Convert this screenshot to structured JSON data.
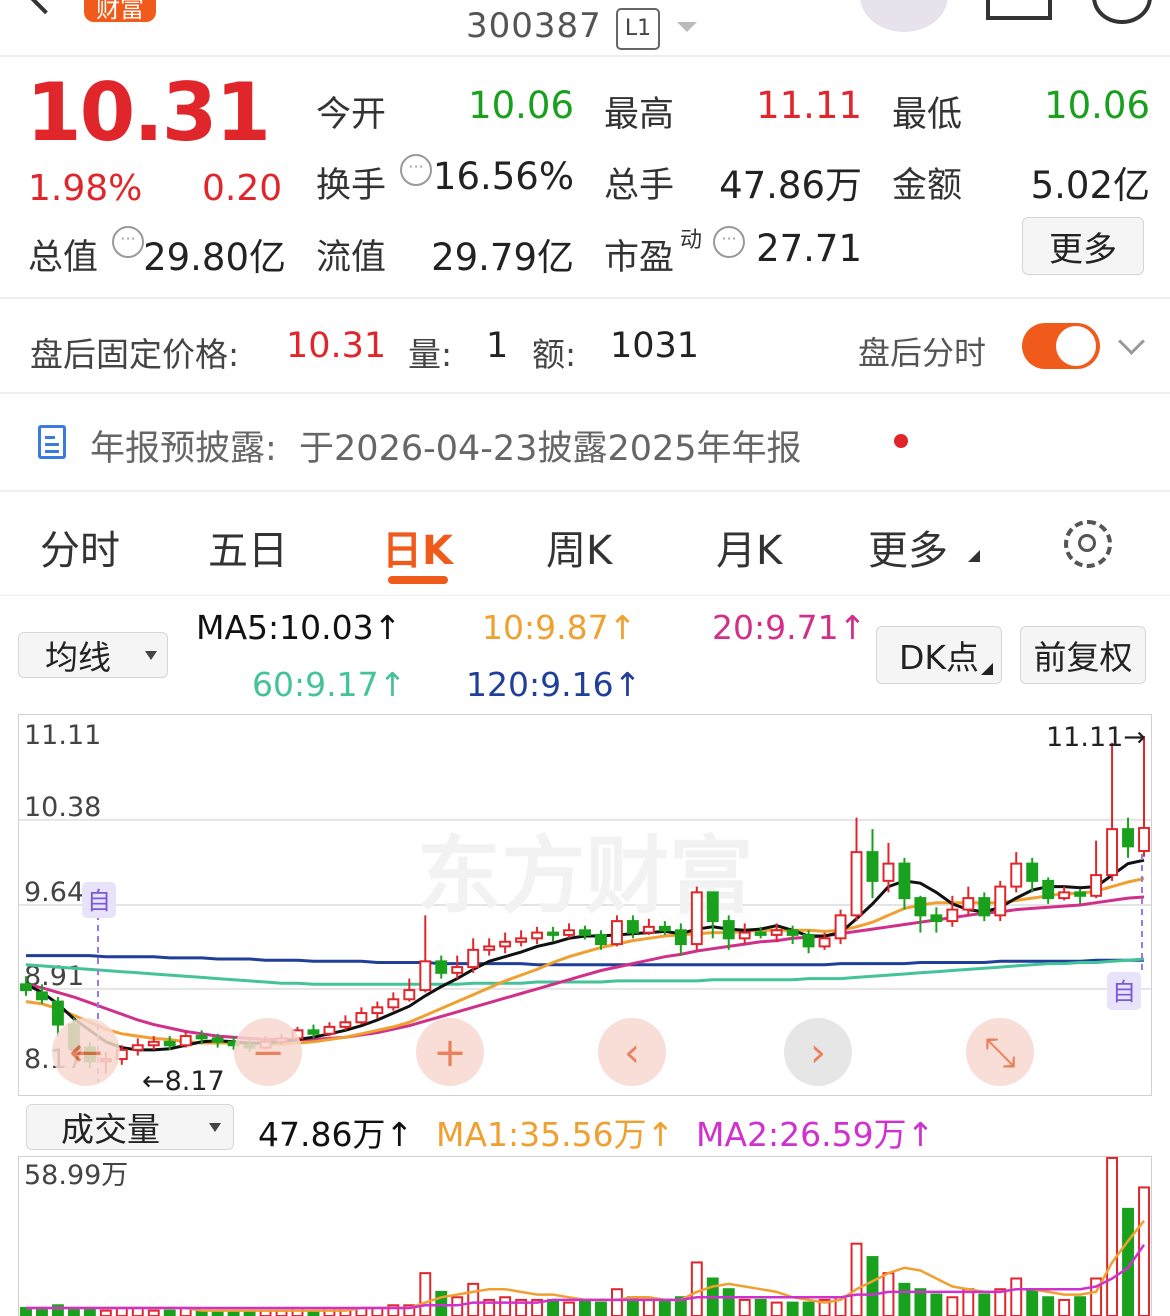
{
  "header": {
    "badge": "财富",
    "code": "300387",
    "level": "L1"
  },
  "quote": {
    "price": "10.31",
    "pct": "1.98%",
    "chg": "0.20",
    "open_label": "今开",
    "open": "10.06",
    "high_label": "最高",
    "high": "11.11",
    "low_label": "最低",
    "low": "10.06",
    "turnover_label": "换手",
    "turnover": "16.56%",
    "volume_label": "总手",
    "volume": "47.86万",
    "amount_label": "金额",
    "amount": "5.02亿",
    "mktcap_label": "总值",
    "mktcap": "29.80亿",
    "float_label": "流值",
    "float": "29.79亿",
    "pe_label": "市盈",
    "pe_sup": "动",
    "pe": "27.71",
    "more": "更多"
  },
  "afterhours": {
    "label": "盘后固定价格:",
    "price": "10.31",
    "qty_label": "量:",
    "qty": "1",
    "amt_label": "额:",
    "amt": "1031",
    "toggle_label": "盘后分时",
    "toggle_on": true
  },
  "notice": {
    "text": "年报预披露:  于2026-04-23披露2025年年报"
  },
  "tabs": [
    "分时",
    "五日",
    "日K",
    "周K",
    "月K",
    "更多"
  ],
  "indicators": {
    "ma_select": "均线",
    "ma5": "MA5:10.03↑",
    "ma10": "10:9.87↑",
    "ma20": "20:9.71↑",
    "ma60": "60:9.17↑",
    "ma120": "120:9.16↑",
    "dk": "DK点",
    "fq": "前复权"
  },
  "kchart": {
    "yticks": [
      "11.11",
      "10.38",
      "9.64",
      "8.91",
      "8.17"
    ],
    "high_label": "11.11→",
    "low_label": "←8.17",
    "watermark": "东方财富",
    "auto_mark": "自"
  },
  "volume": {
    "select": "成交量",
    "value": "47.86万↑",
    "ma1": "MA1:35.56万↑",
    "ma2": "MA2:26.59万↑",
    "ytop": "58.99万"
  },
  "colors": {
    "up": "#e0262b",
    "down": "#19a11e",
    "ma5": "#111111",
    "ma10": "#f0a030",
    "ma20": "#d0308a",
    "ma60": "#44c29a",
    "ma120": "#1f3f9a",
    "accent": "#f05a1a"
  },
  "chart_data": {
    "type": "candlestick",
    "ylim": [
      8.17,
      11.11
    ],
    "candles": [
      [
        8.95,
        8.9,
        9.02,
        8.85
      ],
      [
        8.88,
        8.82,
        8.95,
        8.78
      ],
      [
        8.8,
        8.6,
        8.84,
        8.5
      ],
      [
        8.6,
        8.4,
        8.66,
        8.36
      ],
      [
        8.4,
        8.28,
        8.45,
        8.22
      ],
      [
        8.28,
        8.3,
        8.36,
        8.17
      ],
      [
        8.3,
        8.38,
        8.42,
        8.25
      ],
      [
        8.38,
        8.42,
        8.48,
        8.33
      ],
      [
        8.42,
        8.45,
        8.5,
        8.38
      ],
      [
        8.45,
        8.42,
        8.5,
        8.38
      ],
      [
        8.42,
        8.5,
        8.55,
        8.4
      ],
      [
        8.5,
        8.48,
        8.55,
        8.43
      ],
      [
        8.48,
        8.45,
        8.52,
        8.4
      ],
      [
        8.45,
        8.42,
        8.5,
        8.38
      ],
      [
        8.42,
        8.4,
        8.47,
        8.36
      ],
      [
        8.4,
        8.45,
        8.5,
        8.38
      ],
      [
        8.45,
        8.48,
        8.52,
        8.42
      ],
      [
        8.48,
        8.55,
        8.58,
        8.45
      ],
      [
        8.55,
        8.52,
        8.6,
        8.48
      ],
      [
        8.52,
        8.58,
        8.62,
        8.5
      ],
      [
        8.58,
        8.62,
        8.68,
        8.55
      ],
      [
        8.62,
        8.7,
        8.75,
        8.6
      ],
      [
        8.7,
        8.75,
        8.8,
        8.65
      ],
      [
        8.75,
        8.82,
        8.88,
        8.72
      ],
      [
        8.82,
        8.9,
        9.0,
        8.8
      ],
      [
        8.9,
        9.15,
        9.55,
        8.88
      ],
      [
        9.15,
        9.05,
        9.2,
        9.0
      ],
      [
        9.05,
        9.1,
        9.2,
        9.0
      ],
      [
        9.1,
        9.25,
        9.35,
        9.05
      ],
      [
        9.25,
        9.28,
        9.35,
        9.2
      ],
      [
        9.28,
        9.32,
        9.4,
        9.22
      ],
      [
        9.32,
        9.35,
        9.42,
        9.28
      ],
      [
        9.35,
        9.4,
        9.45,
        9.3
      ],
      [
        9.4,
        9.38,
        9.45,
        9.32
      ],
      [
        9.38,
        9.42,
        9.48,
        9.35
      ],
      [
        9.42,
        9.38,
        9.46,
        9.34
      ],
      [
        9.38,
        9.3,
        9.42,
        9.25
      ],
      [
        9.3,
        9.5,
        9.55,
        9.28
      ],
      [
        9.5,
        9.4,
        9.55,
        9.35
      ],
      [
        9.4,
        9.45,
        9.52,
        9.38
      ],
      [
        9.45,
        9.42,
        9.5,
        9.38
      ],
      [
        9.42,
        9.3,
        9.48,
        9.2
      ],
      [
        9.3,
        9.75,
        9.8,
        9.25
      ],
      [
        9.75,
        9.5,
        9.75,
        9.35
      ],
      [
        9.5,
        9.35,
        9.55,
        9.25
      ],
      [
        9.35,
        9.4,
        9.48,
        9.3
      ],
      [
        9.4,
        9.38,
        9.45,
        9.35
      ],
      [
        9.38,
        9.42,
        9.48,
        9.32
      ],
      [
        9.42,
        9.38,
        9.46,
        9.3
      ],
      [
        9.38,
        9.28,
        9.42,
        9.22
      ],
      [
        9.28,
        9.35,
        9.4,
        9.25
      ],
      [
        9.35,
        9.55,
        9.6,
        9.3
      ],
      [
        9.55,
        10.1,
        10.4,
        9.5
      ],
      [
        10.1,
        9.85,
        10.3,
        9.7
      ],
      [
        9.85,
        10.0,
        10.18,
        9.75
      ],
      [
        10.0,
        9.7,
        10.05,
        9.6
      ],
      [
        9.7,
        9.55,
        9.72,
        9.4
      ],
      [
        9.55,
        9.5,
        9.62,
        9.4
      ],
      [
        9.5,
        9.6,
        9.72,
        9.45
      ],
      [
        9.6,
        9.7,
        9.8,
        9.55
      ],
      [
        9.7,
        9.55,
        9.75,
        9.5
      ],
      [
        9.55,
        9.8,
        9.85,
        9.5
      ],
      [
        9.8,
        10.0,
        10.1,
        9.75
      ],
      [
        10.0,
        9.85,
        10.05,
        9.75
      ],
      [
        9.85,
        9.7,
        9.88,
        9.65
      ],
      [
        9.7,
        9.75,
        9.8,
        9.68
      ],
      [
        9.75,
        9.72,
        9.78,
        9.65
      ],
      [
        9.72,
        9.9,
        10.2,
        9.7
      ],
      [
        9.9,
        10.3,
        11.05,
        9.85
      ],
      [
        10.3,
        10.15,
        10.4,
        10.05
      ],
      [
        10.11,
        10.31,
        11.11,
        10.06
      ]
    ],
    "ma5": [
      8.95,
      8.88,
      8.78,
      8.65,
      8.55,
      8.45,
      8.4,
      8.38,
      8.38,
      8.39,
      8.42,
      8.45,
      8.46,
      8.45,
      8.44,
      8.44,
      8.45,
      8.47,
      8.49,
      8.52,
      8.55,
      8.59,
      8.64,
      8.7,
      8.76,
      8.85,
      8.93,
      9.0,
      9.08,
      9.15,
      9.19,
      9.23,
      9.28,
      9.31,
      9.35,
      9.37,
      9.37,
      9.38,
      9.39,
      9.4,
      9.41,
      9.39,
      9.43,
      9.45,
      9.43,
      9.42,
      9.43,
      9.46,
      9.42,
      9.37,
      9.37,
      9.4,
      9.52,
      9.65,
      9.8,
      9.85,
      9.83,
      9.75,
      9.65,
      9.6,
      9.58,
      9.62,
      9.7,
      9.77,
      9.8,
      9.8,
      9.79,
      9.8,
      9.9,
      10.0,
      10.03
    ],
    "ma10": [
      8.8,
      8.78,
      8.74,
      8.68,
      8.62,
      8.56,
      8.52,
      8.5,
      8.48,
      8.47,
      8.45,
      8.44,
      8.44,
      8.44,
      8.44,
      8.43,
      8.43,
      8.44,
      8.45,
      8.47,
      8.49,
      8.52,
      8.55,
      8.58,
      8.62,
      8.68,
      8.74,
      8.8,
      8.86,
      8.92,
      8.98,
      9.03,
      9.08,
      9.14,
      9.19,
      9.23,
      9.27,
      9.3,
      9.33,
      9.35,
      9.37,
      9.38,
      9.39,
      9.4,
      9.4,
      9.41,
      9.42,
      9.42,
      9.42,
      9.42,
      9.41,
      9.42,
      9.45,
      9.49,
      9.55,
      9.61,
      9.64,
      9.66,
      9.66,
      9.66,
      9.66,
      9.66,
      9.68,
      9.7,
      9.72,
      9.74,
      9.74,
      9.76,
      9.8,
      9.84,
      9.87
    ],
    "ma20": [
      8.95,
      8.92,
      8.88,
      8.84,
      8.79,
      8.74,
      8.69,
      8.64,
      8.6,
      8.57,
      8.54,
      8.52,
      8.5,
      8.49,
      8.48,
      8.47,
      8.47,
      8.47,
      8.47,
      8.48,
      8.49,
      8.51,
      8.53,
      8.56,
      8.59,
      8.63,
      8.67,
      8.71,
      8.75,
      8.79,
      8.83,
      8.87,
      8.91,
      8.95,
      8.99,
      9.03,
      9.07,
      9.1,
      9.13,
      9.16,
      9.19,
      9.21,
      9.24,
      9.26,
      9.28,
      9.3,
      9.32,
      9.33,
      9.35,
      9.36,
      9.37,
      9.39,
      9.41,
      9.43,
      9.45,
      9.47,
      9.49,
      9.51,
      9.53,
      9.55,
      9.57,
      9.58,
      9.6,
      9.61,
      9.62,
      9.63,
      9.64,
      9.66,
      9.68,
      9.7,
      9.71
    ],
    "ma60": [
      9.12,
      9.11,
      9.1,
      9.09,
      9.08,
      9.07,
      9.06,
      9.05,
      9.04,
      9.03,
      9.02,
      9.01,
      9.0,
      8.99,
      8.98,
      8.97,
      8.96,
      8.96,
      8.95,
      8.95,
      8.95,
      8.95,
      8.95,
      8.95,
      8.95,
      8.95,
      8.95,
      8.95,
      8.96,
      8.96,
      8.96,
      8.96,
      8.97,
      8.97,
      8.97,
      8.97,
      8.97,
      8.98,
      8.98,
      8.98,
      8.98,
      8.98,
      8.98,
      8.99,
      8.99,
      8.99,
      8.99,
      8.99,
      8.99,
      9.0,
      9.0,
      9.0,
      9.01,
      9.02,
      9.03,
      9.04,
      9.05,
      9.06,
      9.07,
      9.08,
      9.09,
      9.1,
      9.11,
      9.12,
      9.13,
      9.13,
      9.14,
      9.14,
      9.15,
      9.16,
      9.17
    ],
    "ma120": [
      9.2,
      9.2,
      9.2,
      9.2,
      9.2,
      9.19,
      9.19,
      9.19,
      9.19,
      9.18,
      9.18,
      9.18,
      9.17,
      9.17,
      9.17,
      9.16,
      9.16,
      9.16,
      9.15,
      9.15,
      9.15,
      9.15,
      9.14,
      9.14,
      9.14,
      9.14,
      9.13,
      9.13,
      9.13,
      9.13,
      9.13,
      9.13,
      9.12,
      9.12,
      9.12,
      9.12,
      9.12,
      9.12,
      9.12,
      9.12,
      9.12,
      9.12,
      9.12,
      9.12,
      9.12,
      9.12,
      9.12,
      9.12,
      9.12,
      9.12,
      9.12,
      9.13,
      9.13,
      9.13,
      9.13,
      9.13,
      9.14,
      9.14,
      9.14,
      9.14,
      9.14,
      9.15,
      9.15,
      9.15,
      9.15,
      9.15,
      9.15,
      9.16,
      9.16,
      9.16,
      9.16
    ],
    "vol": [
      3,
      3,
      4,
      3,
      3,
      2,
      3,
      3,
      2,
      2,
      3,
      2,
      2,
      2,
      2,
      2,
      2,
      3,
      2,
      3,
      3,
      3,
      3,
      4,
      4,
      16,
      9,
      7,
      12,
      6,
      7,
      6,
      6,
      6,
      5,
      6,
      5,
      10,
      7,
      6,
      6,
      7,
      20,
      14,
      10,
      6,
      6,
      5,
      5,
      5,
      6,
      7,
      27,
      22,
      16,
      12,
      10,
      8,
      7,
      10,
      8,
      10,
      14,
      10,
      7,
      6,
      7,
      14,
      59,
      40,
      48
    ],
    "vol_ma1": [
      3,
      3,
      3,
      3,
      3,
      3,
      3,
      3,
      3,
      3,
      3,
      2,
      2,
      2,
      2,
      2,
      2,
      2,
      2,
      2,
      2,
      3,
      3,
      3,
      3,
      5,
      7,
      8,
      9,
      10,
      10,
      9,
      8,
      8,
      7,
      6,
      6,
      6,
      7,
      7,
      6,
      6,
      9,
      11,
      12,
      11,
      10,
      9,
      7,
      6,
      5,
      6,
      10,
      13,
      16,
      18,
      17,
      14,
      11,
      10,
      9,
      9,
      10,
      10,
      9,
      8,
      8,
      9,
      20,
      28,
      35.56
    ],
    "vol_ma2": [
      3,
      3,
      3,
      3,
      3,
      3,
      3,
      3,
      3,
      3,
      3,
      3,
      3,
      3,
      3,
      3,
      3,
      3,
      3,
      3,
      3,
      3,
      3,
      3,
      3,
      4,
      4,
      4,
      5,
      5,
      5,
      5,
      5,
      6,
      6,
      6,
      6,
      6,
      6,
      6,
      6,
      6,
      7,
      7,
      7,
      7,
      7,
      7,
      7,
      7,
      7,
      7,
      8,
      8,
      9,
      9,
      9,
      9,
      9,
      9,
      9,
      9,
      10,
      10,
      10,
      10,
      10,
      11,
      14,
      18,
      26.59
    ],
    "vol_ylim": [
      0,
      58.99
    ]
  }
}
